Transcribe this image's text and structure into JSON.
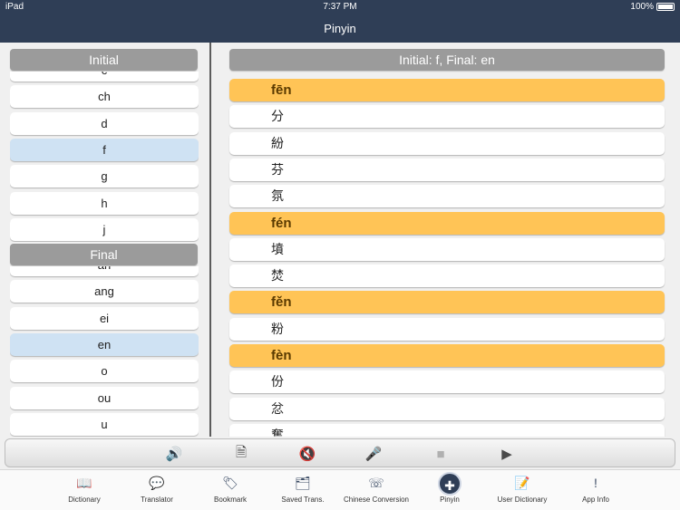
{
  "status": {
    "device": "iPad",
    "time": "7:37 PM",
    "battery": "100%"
  },
  "nav": {
    "title": "Pinyin"
  },
  "initial": {
    "header": "Initial",
    "items": [
      {
        "label": "c",
        "selected": false
      },
      {
        "label": "ch",
        "selected": false
      },
      {
        "label": "d",
        "selected": false
      },
      {
        "label": "f",
        "selected": true
      },
      {
        "label": "g",
        "selected": false
      },
      {
        "label": "h",
        "selected": false
      },
      {
        "label": "j",
        "selected": false
      }
    ]
  },
  "final": {
    "header": "Final",
    "items": [
      {
        "label": "an",
        "selected": false
      },
      {
        "label": "ang",
        "selected": false
      },
      {
        "label": "ei",
        "selected": false
      },
      {
        "label": "en",
        "selected": true
      },
      {
        "label": "o",
        "selected": false
      },
      {
        "label": "ou",
        "selected": false
      },
      {
        "label": "u",
        "selected": false
      }
    ]
  },
  "results": {
    "header": "Initial: f, Final: en",
    "rows": [
      {
        "text": "fēn",
        "type": "pinyin"
      },
      {
        "text": "分",
        "type": "char"
      },
      {
        "text": "紛",
        "type": "char"
      },
      {
        "text": "芬",
        "type": "char"
      },
      {
        "text": "氛",
        "type": "char"
      },
      {
        "text": "fén",
        "type": "pinyin"
      },
      {
        "text": "墳",
        "type": "char"
      },
      {
        "text": "焚",
        "type": "char"
      },
      {
        "text": "fěn",
        "type": "pinyin"
      },
      {
        "text": "粉",
        "type": "char"
      },
      {
        "text": "fèn",
        "type": "pinyin"
      },
      {
        "text": "份",
        "type": "char"
      },
      {
        "text": "忿",
        "type": "char"
      },
      {
        "text": "奮",
        "type": "char"
      }
    ]
  },
  "toolbar": [
    {
      "icon": "speaker-icon",
      "glyph": "🔊",
      "enabled": true
    },
    {
      "icon": "document-audio-icon",
      "glyph": "🗎",
      "enabled": true
    },
    {
      "icon": "mute-icon",
      "glyph": "🔇",
      "enabled": false
    },
    {
      "icon": "microphone-icon",
      "glyph": "🎤",
      "enabled": true
    },
    {
      "icon": "stop-icon",
      "glyph": "■",
      "enabled": false
    },
    {
      "icon": "play-icon",
      "glyph": "▶",
      "enabled": true
    }
  ],
  "tabs": [
    {
      "label": "Dictionary",
      "icon": "book-icon",
      "glyph": "📖",
      "active": false
    },
    {
      "label": "Translator",
      "icon": "translate-icon",
      "glyph": "💬",
      "active": false
    },
    {
      "label": "Bookmark",
      "icon": "bookmark-icon",
      "glyph": "🏷",
      "active": false
    },
    {
      "label": "Saved Trans.",
      "icon": "saved-translations-icon",
      "glyph": "🗂",
      "active": false
    },
    {
      "label": "Chinese Conversion",
      "icon": "conversion-icon",
      "glyph": "☏",
      "active": false
    },
    {
      "label": "Pinyin",
      "icon": "pinyin-icon",
      "glyph": "✚",
      "active": true
    },
    {
      "label": "User Dictionary",
      "icon": "user-dictionary-icon",
      "glyph": "📝",
      "active": false
    },
    {
      "label": "App Info",
      "icon": "info-icon",
      "glyph": "!",
      "active": false
    }
  ]
}
